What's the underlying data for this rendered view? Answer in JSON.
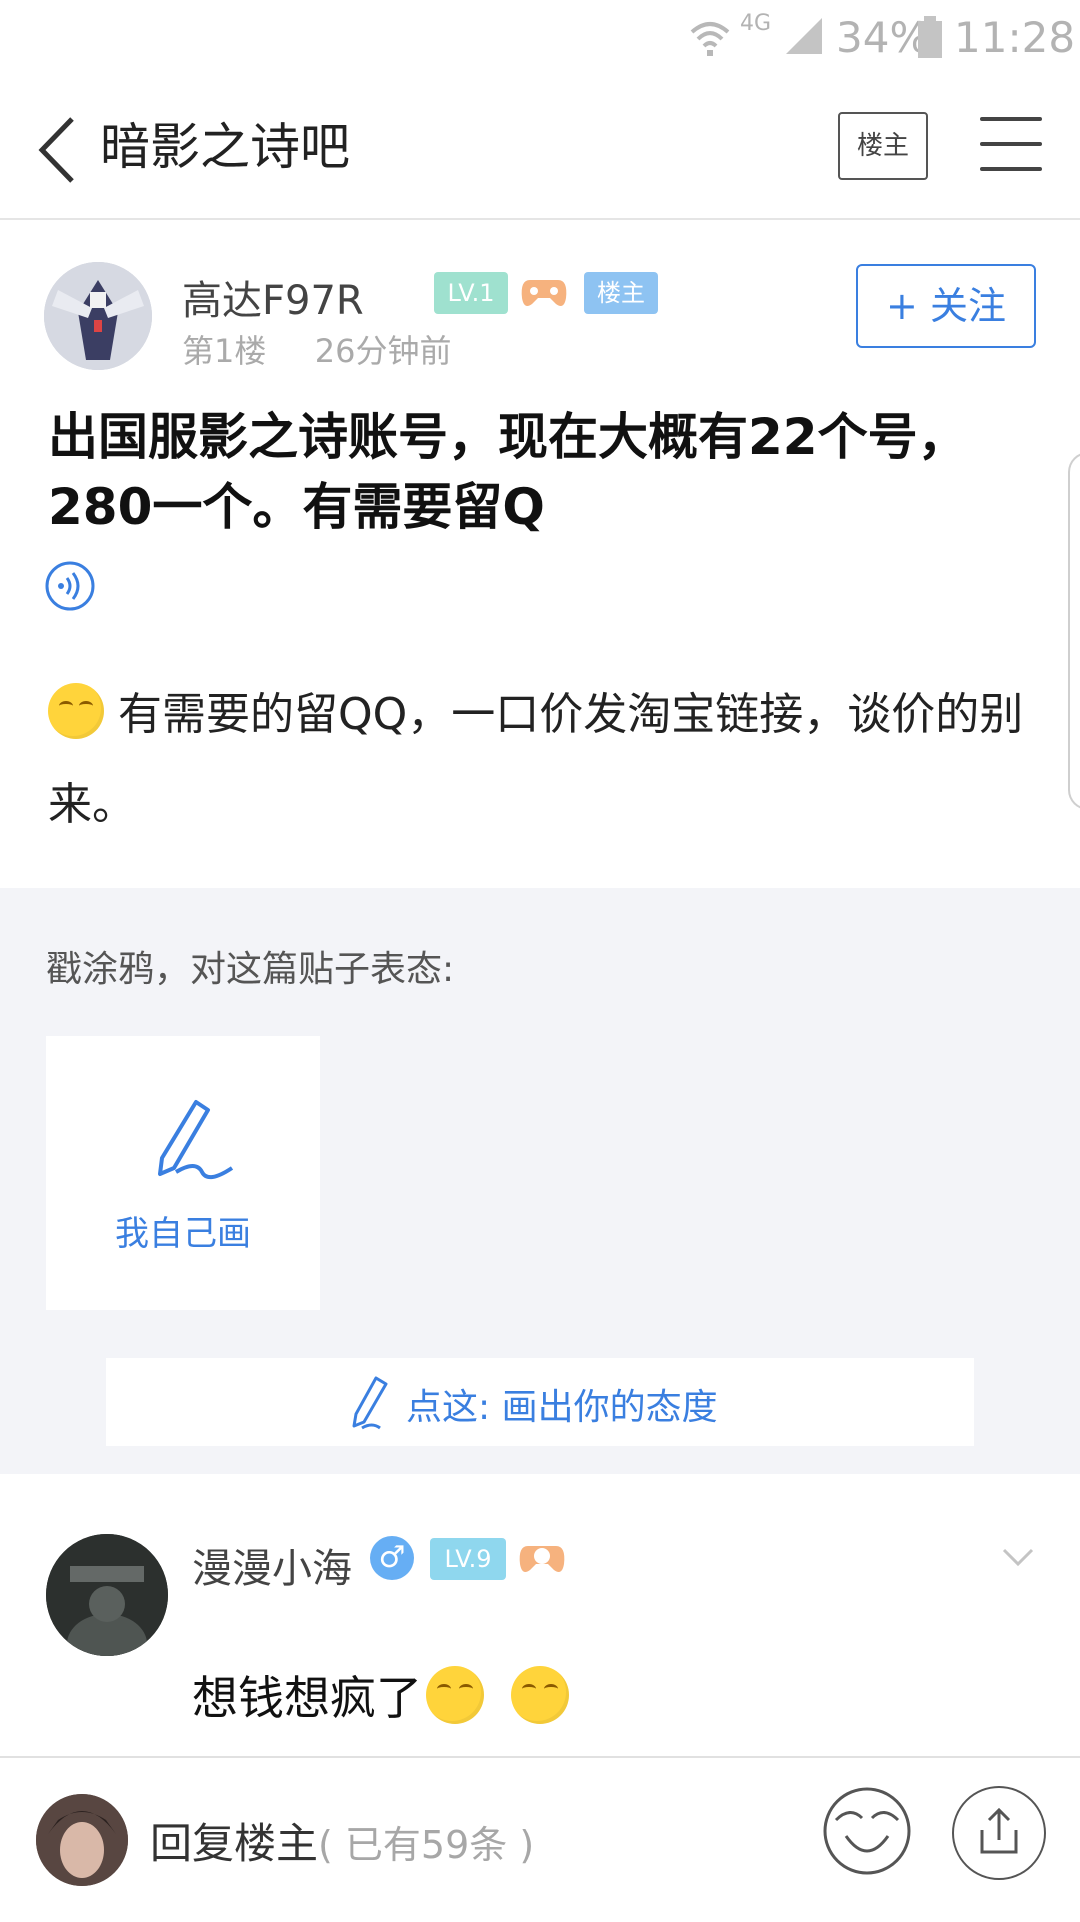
{
  "status_bar": {
    "network": "4G",
    "battery": "34%",
    "time": "11:28"
  },
  "header": {
    "title": "暗影之诗吧",
    "owner_button": "楼主"
  },
  "post": {
    "author": "高达F97R",
    "level_badge": "LV.1",
    "owner_badge": "楼主",
    "floor": "第1楼",
    "time_ago": "26分钟前",
    "follow_label": "+ 关注",
    "title": "出国服影之诗账号，现在大概有22个号，280一个。有需要留Q",
    "body": "有需要的留QQ，一口价发淘宝链接，谈价的别来。"
  },
  "graffiti": {
    "title": "戳涂鸦，对这篇贴子表态:",
    "card_label": "我自己画",
    "bar_label": "点这: 画出你的态度"
  },
  "comment": {
    "author": "漫漫小海",
    "gender_badge": "♂",
    "level_badge": "LV.9",
    "text": "想钱想疯了"
  },
  "bottom_bar": {
    "reply_label": "回复楼主",
    "reply_count": "( 已有59条 )"
  },
  "colors": {
    "accent": "#3a7fe0",
    "level_badge": "#9fe1cf",
    "owner_badge": "#8ec3f2",
    "comment_level_badge": "#8fd7ee"
  }
}
